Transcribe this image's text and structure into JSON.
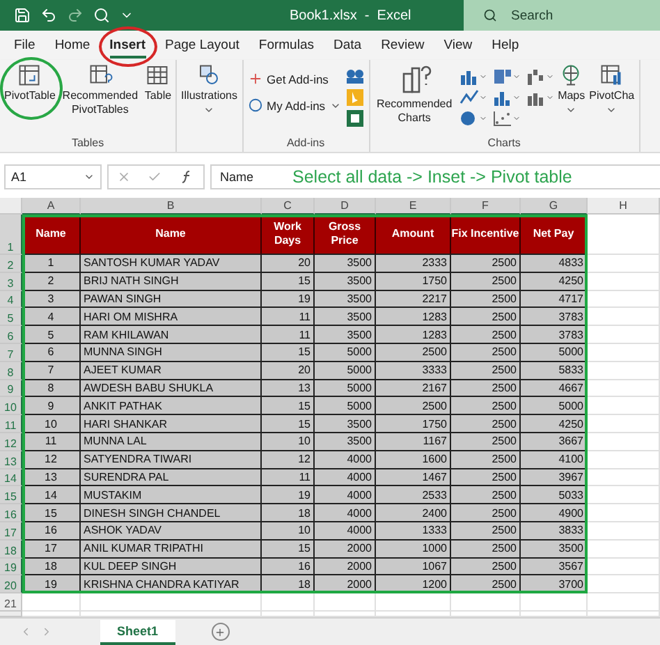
{
  "window": {
    "title": "Book1.xlsx  -  Excel"
  },
  "search": {
    "placeholder": "Search"
  },
  "tabs": [
    {
      "label": "File",
      "selected": false,
      "circled": false
    },
    {
      "label": "Home",
      "selected": false,
      "circled": false
    },
    {
      "label": "Insert",
      "selected": true,
      "circled": true
    },
    {
      "label": "Page Layout",
      "selected": false,
      "circled": false
    },
    {
      "label": "Formulas",
      "selected": false,
      "circled": false
    },
    {
      "label": "Data",
      "selected": false,
      "circled": false
    },
    {
      "label": "Review",
      "selected": false,
      "circled": false
    },
    {
      "label": "View",
      "selected": false,
      "circled": false
    },
    {
      "label": "Help",
      "selected": false,
      "circled": false
    }
  ],
  "ribbon": [
    {
      "label": "Tables",
      "items": [
        {
          "kind": "large",
          "label": "PivotTable",
          "circled": true,
          "dropdown": false
        },
        {
          "kind": "large",
          "label": "Recommended PivotTables",
          "circled": false,
          "dropdown": false
        },
        {
          "kind": "large",
          "label": "Table",
          "circled": false,
          "dropdown": false
        }
      ]
    },
    {
      "items": [
        {
          "kind": "large",
          "label": "Illustrations",
          "circled": false,
          "dropdown": true
        }
      ]
    },
    {
      "label": "Add-ins",
      "items": [
        {
          "kind": "small",
          "label": "Get Add-ins",
          "dropdown": false
        },
        {
          "kind": "small",
          "label": "My Add-ins",
          "dropdown": true
        },
        {
          "kind": "icons"
        }
      ]
    },
    {
      "label": "Charts",
      "items": [
        {
          "kind": "large",
          "label": "Recommended Charts",
          "circled": false,
          "dropdown": false
        },
        {
          "kind": "icons"
        },
        {
          "kind": "large",
          "label": "Maps",
          "circled": false,
          "dropdown": true
        },
        {
          "kind": "large",
          "label": "PivotCha",
          "circled": false,
          "dropdown": true
        }
      ]
    }
  ],
  "formula_bar": {
    "name_box": "A1",
    "value": "Name",
    "note": "Select all data -> Inset -> Pivot table"
  },
  "sheet": {
    "columns": [
      "A",
      "B",
      "C",
      "D",
      "E",
      "F",
      "G",
      "H"
    ],
    "data_selected": true,
    "header": [
      "Name",
      "Name",
      "Work Days",
      "Gross Price",
      "Amount",
      "Fix Incentive",
      "Net Pay"
    ],
    "rows": [
      [
        "1",
        "SANTOSH KUMAR YADAV",
        "20",
        "3500",
        "2333",
        "2500",
        "4833"
      ],
      [
        "2",
        "BRIJ NATH SINGH",
        "15",
        "3500",
        "1750",
        "2500",
        "4250"
      ],
      [
        "3",
        "PAWAN SINGH",
        "19",
        "3500",
        "2217",
        "2500",
        "4717"
      ],
      [
        "4",
        "HARI OM MISHRA",
        "11",
        "3500",
        "1283",
        "2500",
        "3783"
      ],
      [
        "5",
        "RAM KHILAWAN",
        "11",
        "3500",
        "1283",
        "2500",
        "3783"
      ],
      [
        "6",
        "MUNNA SINGH",
        "15",
        "5000",
        "2500",
        "2500",
        "5000"
      ],
      [
        "7",
        "AJEET KUMAR",
        "20",
        "5000",
        "3333",
        "2500",
        "5833"
      ],
      [
        "8",
        "AWDESH BABU SHUKLA",
        "13",
        "5000",
        "2167",
        "2500",
        "4667"
      ],
      [
        "9",
        "ANKIT PATHAK",
        "15",
        "5000",
        "2500",
        "2500",
        "5000"
      ],
      [
        "10",
        "HARI SHANKAR",
        "15",
        "3500",
        "1750",
        "2500",
        "4250"
      ],
      [
        "11",
        "MUNNA LAL",
        "10",
        "3500",
        "1167",
        "2500",
        "3667"
      ],
      [
        "12",
        "SATYENDRA TIWARI",
        "12",
        "4000",
        "1600",
        "2500",
        "4100"
      ],
      [
        "13",
        "SURENDRA PAL",
        "11",
        "4000",
        "1467",
        "2500",
        "3967"
      ],
      [
        "14",
        "MUSTAKIM",
        "19",
        "4000",
        "2533",
        "2500",
        "5033"
      ],
      [
        "15",
        "DINESH SINGH CHANDEL",
        "18",
        "4000",
        "2400",
        "2500",
        "4900"
      ],
      [
        "16",
        "ASHOK YADAV",
        "10",
        "4000",
        "1333",
        "2500",
        "3833"
      ],
      [
        "17",
        "ANIL KUMAR TRIPATHI",
        "15",
        "2000",
        "1000",
        "2500",
        "3500"
      ],
      [
        "18",
        "KUL DEEP SINGH",
        "16",
        "2000",
        "1067",
        "2500",
        "3567"
      ],
      [
        "19",
        "KRISHNA CHANDRA KATIYAR",
        "18",
        "2000",
        "1200",
        "2500",
        "3700"
      ]
    ],
    "row_numbers": [
      "1",
      "2",
      "3",
      "4",
      "5",
      "6",
      "7",
      "8",
      "9",
      "10",
      "11",
      "12",
      "13",
      "14",
      "15",
      "16",
      "17",
      "18",
      "19",
      "20"
    ],
    "extra_rows": [
      "21"
    ]
  },
  "sheet_tabs": [
    {
      "label": "Sheet1",
      "selected": true
    }
  ]
}
